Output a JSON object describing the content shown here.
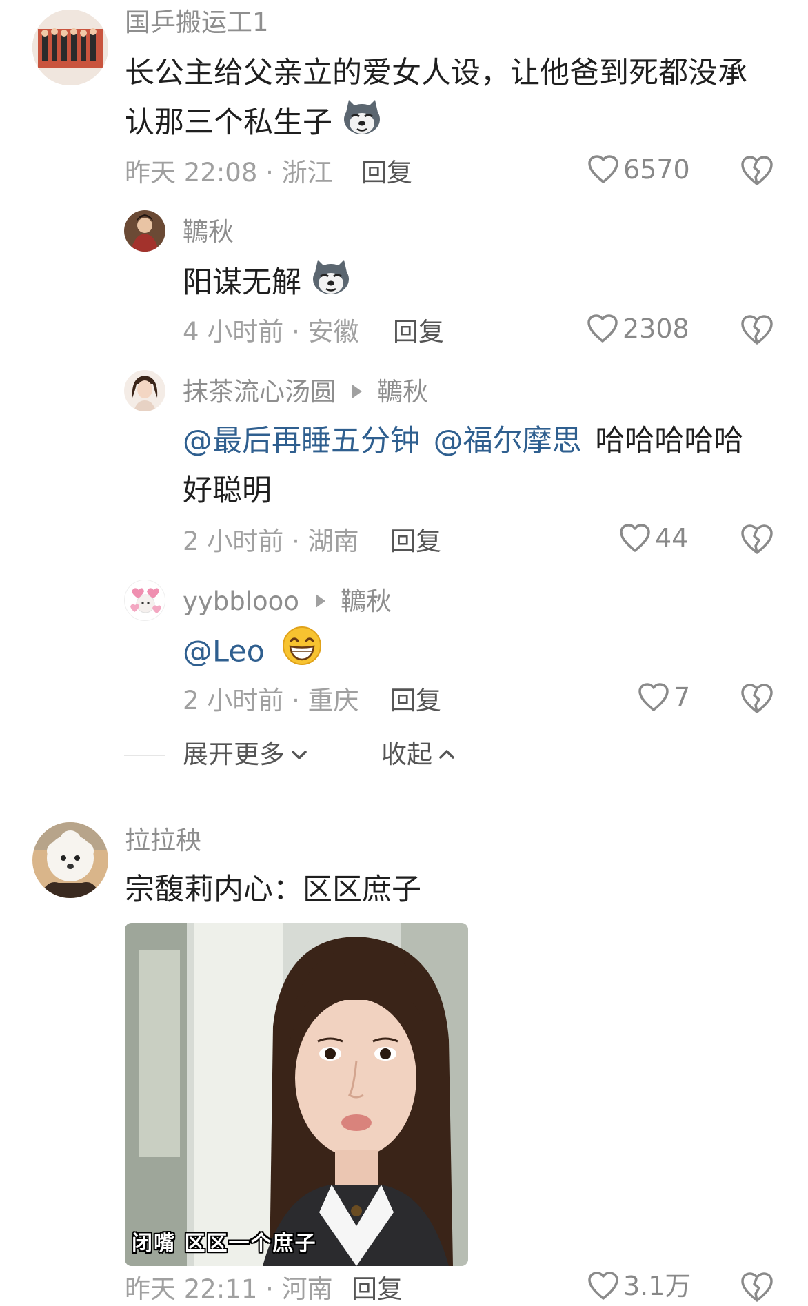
{
  "comments": [
    {
      "username": "国乒搬运工1",
      "text_line1": "长公主给父亲立的爱女人设，让他爸到死都没承",
      "text_line2": "认那三个私生子",
      "meta": "昨天 22:08 · 浙江",
      "reply": "回复",
      "likes": "6570"
    },
    {
      "username": "韀秋",
      "text": "阳谋无解",
      "meta": "4 小时前 · 安徽",
      "reply": "回复",
      "likes": "2308"
    },
    {
      "username": "抹茶流心汤圆",
      "reply_to": "韀秋",
      "mention1": "@最后再睡五分钟",
      "mention2": "@福尔摩思",
      "text_tail": "哈哈哈哈哈",
      "text_line2": "好聪明",
      "meta": "2 小时前 · 湖南",
      "reply": "回复",
      "likes": "44"
    },
    {
      "username": "yybblooo",
      "reply_to": "韀秋",
      "mention": "@Leo",
      "meta": "2 小时前 · 重庆",
      "reply": "回复",
      "likes": "7"
    },
    {
      "username": "拉拉秧",
      "text": "宗馥莉内心：区区庶子",
      "image_caption": "闭嘴 区区一个庶子",
      "meta": "昨天 22:11 · 河南",
      "reply": "回复",
      "likes": "3.1万"
    }
  ],
  "thread_controls": {
    "expand": "展开更多",
    "collapse": "收起"
  },
  "icons": {
    "like": "heart-outline-icon",
    "dislike": "broken-heart-icon",
    "expand": "chevron-down-icon",
    "collapse": "chevron-up-icon"
  },
  "colors": {
    "mention": "#2f5f8f",
    "meta": "#a0a0a0",
    "text": "#1f1f1f"
  }
}
